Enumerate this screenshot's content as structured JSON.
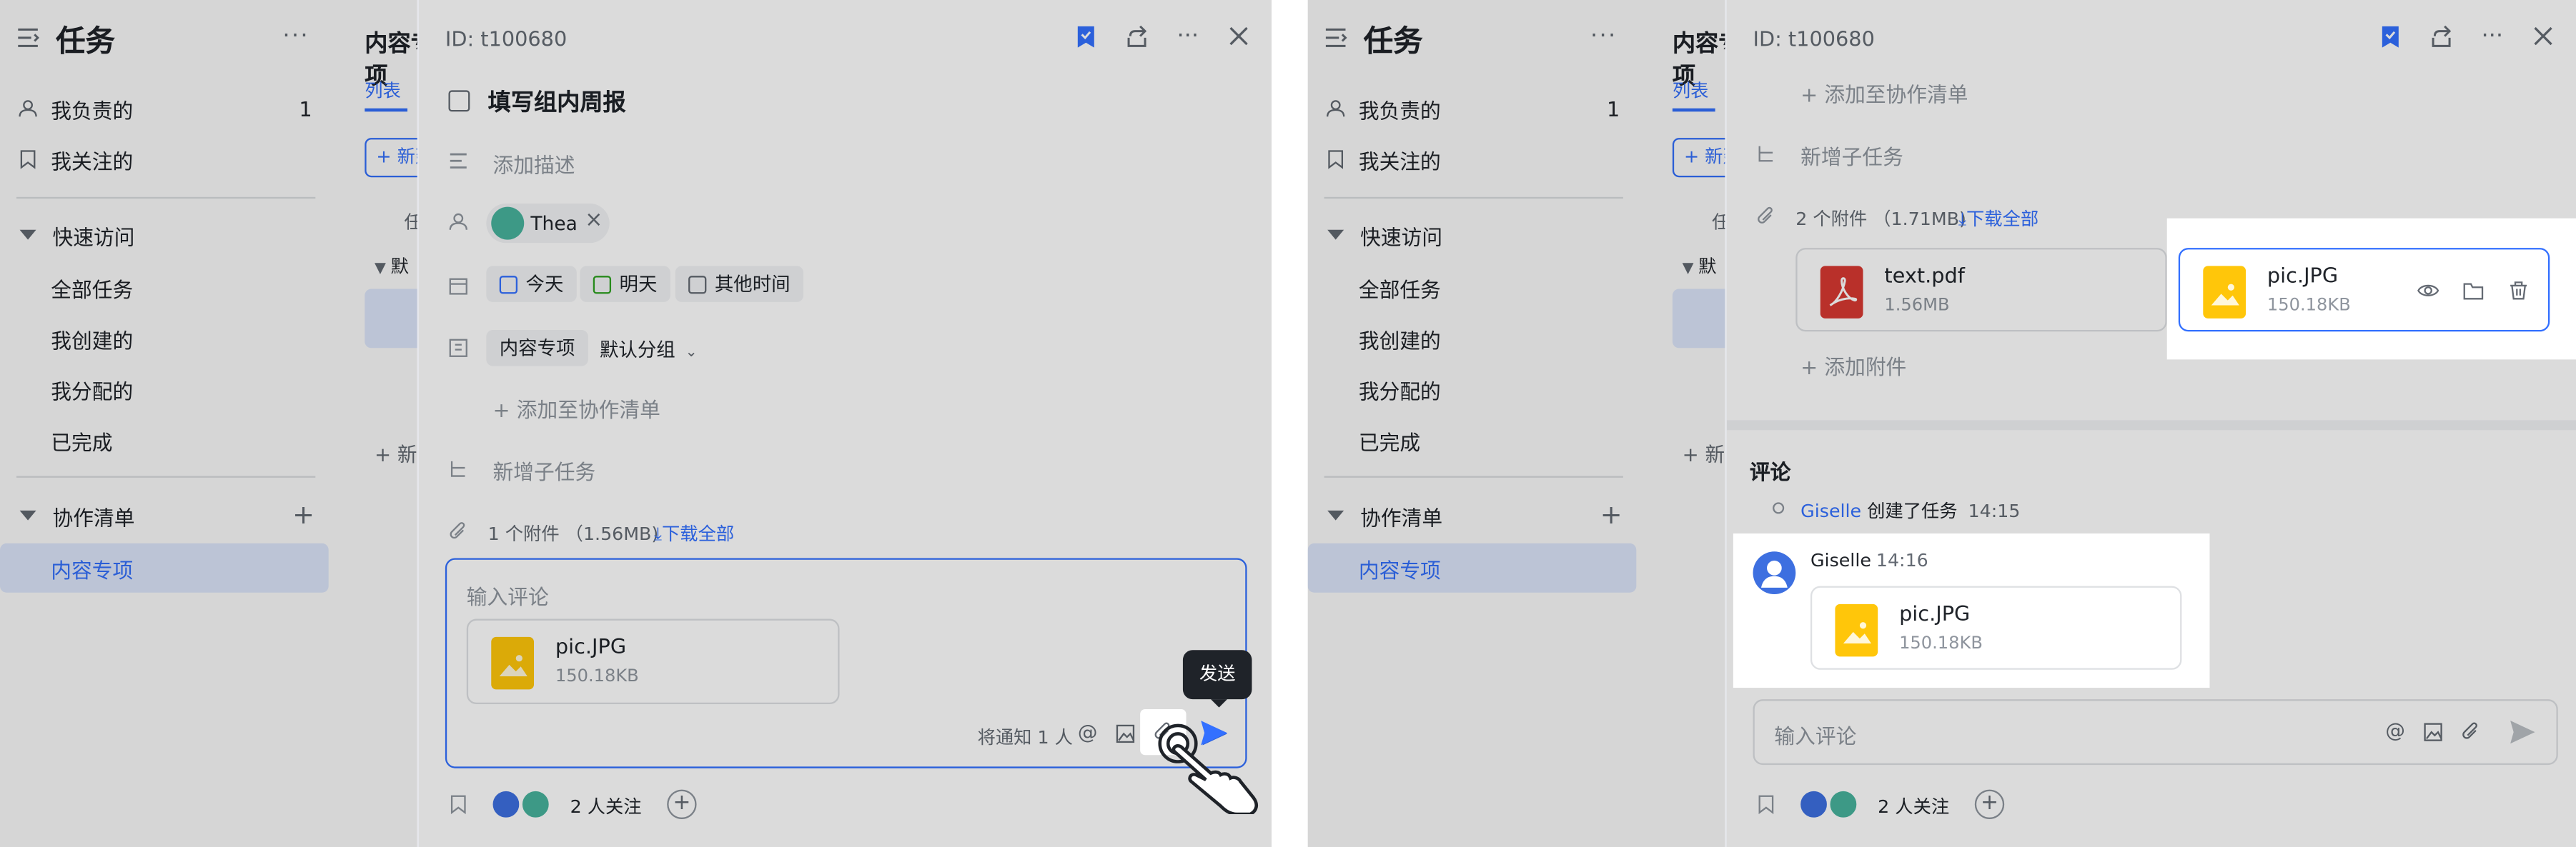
{
  "sidebar": {
    "title": "任务",
    "items": [
      {
        "label": "我负责的",
        "count": "1"
      },
      {
        "label": "我关注的"
      }
    ],
    "quick_access": {
      "label": "快速访问",
      "items": [
        "全部任务",
        "我创建的",
        "我分配的",
        "已完成"
      ]
    },
    "collab": {
      "label": "协作清单",
      "items": [
        "内容专项"
      ]
    }
  },
  "list": {
    "title": "内容专项",
    "tab": "列表",
    "new_button": "+ 新建",
    "col_header": "任",
    "group": "默",
    "add_row": "+ 新"
  },
  "task": {
    "id_label": "ID: t100680",
    "title": "填写组内周报",
    "description_placeholder": "添加描述",
    "assignee": "Thea",
    "due_today": "今天",
    "due_tomorrow": "明天",
    "due_other": "其他时间",
    "list_name": "内容专项",
    "group_name": "默认分组",
    "add_to_list": "+ 添加至协作清单",
    "add_subtask": "新增子任务",
    "add_attachment": "+ 添加附件",
    "download_all": "下载全部",
    "followers": "2 人关注"
  },
  "left_panel": {
    "attachments_summary": "1 个附件 （1.56MB)",
    "comment_placeholder": "输入评论",
    "draft_file": {
      "name": "pic.JPG",
      "size": "150.18KB"
    },
    "notify_text": "将通知 1 人",
    "tooltip": "发送"
  },
  "right_panel": {
    "attachments_summary": "2 个附件 （1.71MB)",
    "files": [
      {
        "name": "text.pdf",
        "size": "1.56MB"
      },
      {
        "name": "pic.JPG",
        "size": "150.18KB"
      }
    ],
    "comments_heading": "评论",
    "activity": {
      "user": "Giselle",
      "action": "创建了任务",
      "time": "14:15"
    },
    "comment": {
      "user": "Giselle",
      "time": "14:16",
      "file": {
        "name": "pic.JPG",
        "size": "150.18KB"
      }
    },
    "comment_placeholder": "输入评论"
  },
  "colors": {
    "accent": "#3370ff",
    "pdf": "#d83931",
    "image": "#ffc60a"
  }
}
